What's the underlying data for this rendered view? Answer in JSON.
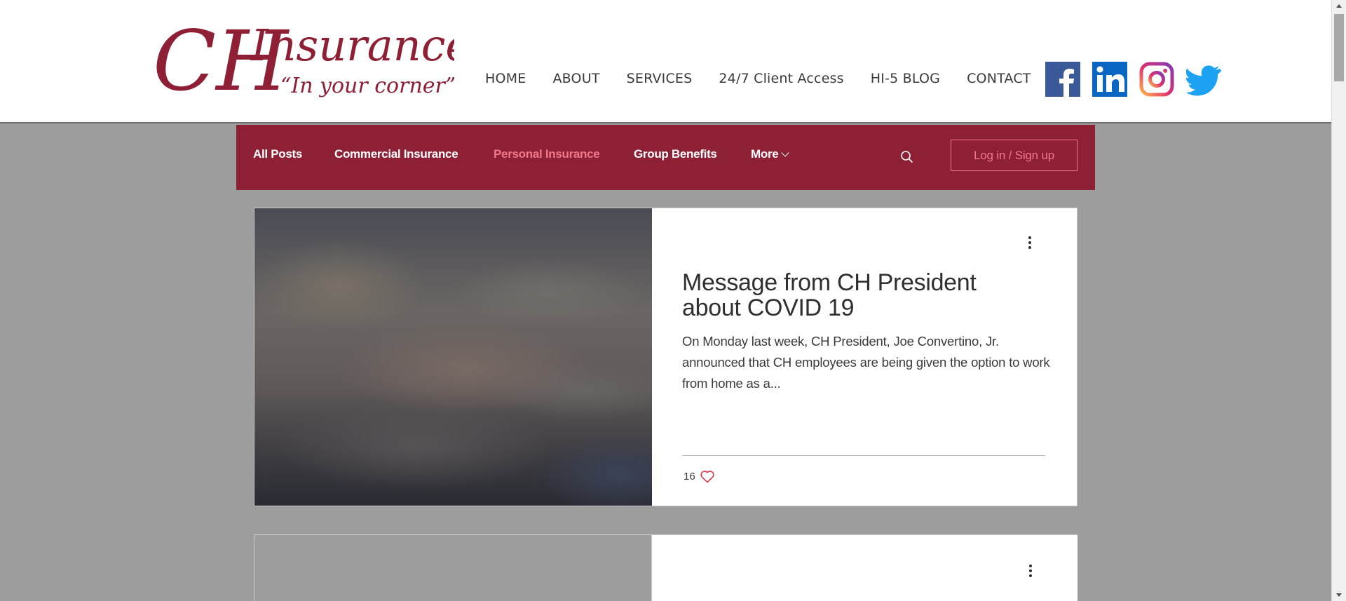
{
  "header": {
    "logo": {
      "monogram": "CH",
      "name": "Insurance",
      "tagline": "“In your corner”"
    },
    "nav": [
      {
        "label": "HOME"
      },
      {
        "label": "ABOUT"
      },
      {
        "label": "SERVICES"
      },
      {
        "label": "24/7 Client Access"
      },
      {
        "label": "HI-5 BLOG"
      },
      {
        "label": "CONTACT"
      }
    ],
    "social": [
      {
        "icon": "facebook-icon",
        "color": "#3b5998"
      },
      {
        "icon": "linkedin-icon",
        "color": "#0a66c2"
      },
      {
        "icon": "instagram-icon",
        "color": "#c13584"
      },
      {
        "icon": "twitter-icon",
        "color": "#1da1f2"
      }
    ]
  },
  "blog_nav": {
    "categories": [
      {
        "label": "All Posts",
        "active": false
      },
      {
        "label": "Commercial Insurance",
        "active": false
      },
      {
        "label": "Personal Insurance",
        "active": true
      },
      {
        "label": "Group Benefits",
        "active": false
      },
      {
        "label": "More",
        "active": false
      }
    ],
    "search_icon": "search-icon",
    "login_label": "Log in / Sign up",
    "colors": {
      "bar": "#8e2035",
      "active": "#f2778d",
      "text": "#ffffff"
    }
  },
  "posts": [
    {
      "title": "Message from CH President about COVID 19",
      "excerpt": "On Monday last week, CH President, Joe Convertino, Jr. announced that CH employees are being given the option to work from home as a...",
      "likes": "16"
    }
  ]
}
